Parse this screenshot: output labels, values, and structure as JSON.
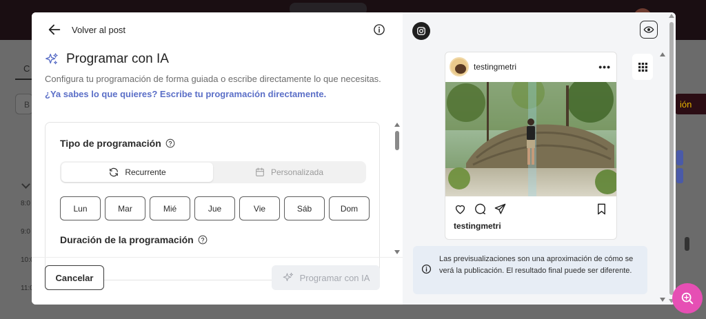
{
  "background": {
    "tab_label": "C",
    "search_placeholder": "B",
    "cta_label": "ión",
    "times": [
      "8:0",
      "9:0",
      "10:0",
      "11:0"
    ]
  },
  "modal": {
    "back_label": "Volver al post",
    "title": "Programar con IA",
    "subtitle": "Configura tu programación de forma guiada o escribe directamente lo que necesitas.",
    "link": "¿Ya sabes lo que quieres? Escribe tu programación directamente.",
    "schedule_type": {
      "title": "Tipo de programación",
      "options": [
        {
          "label": "Recurrente",
          "icon": "refresh-icon",
          "active": true
        },
        {
          "label": "Personalizada",
          "icon": "calendar-icon",
          "active": false
        }
      ]
    },
    "days": [
      "Lun",
      "Mar",
      "Mié",
      "Jue",
      "Vie",
      "Sáb",
      "Dom"
    ],
    "duration_title": "Duración de la programación",
    "cancel_label": "Cancelar",
    "submit_label": "Programar con IA"
  },
  "preview": {
    "network_icon": "instagram-icon",
    "post": {
      "username": "testingmetri",
      "footer_username": "testingmetri"
    },
    "notice": "Las previsualizaciones son una aproximación de cómo se verá la publicación. El resultado final puede ser diferente."
  },
  "colors": {
    "accent_link": "#5b6fc7",
    "fab": "#e64fb4",
    "notice_bg": "#e7edf5"
  }
}
